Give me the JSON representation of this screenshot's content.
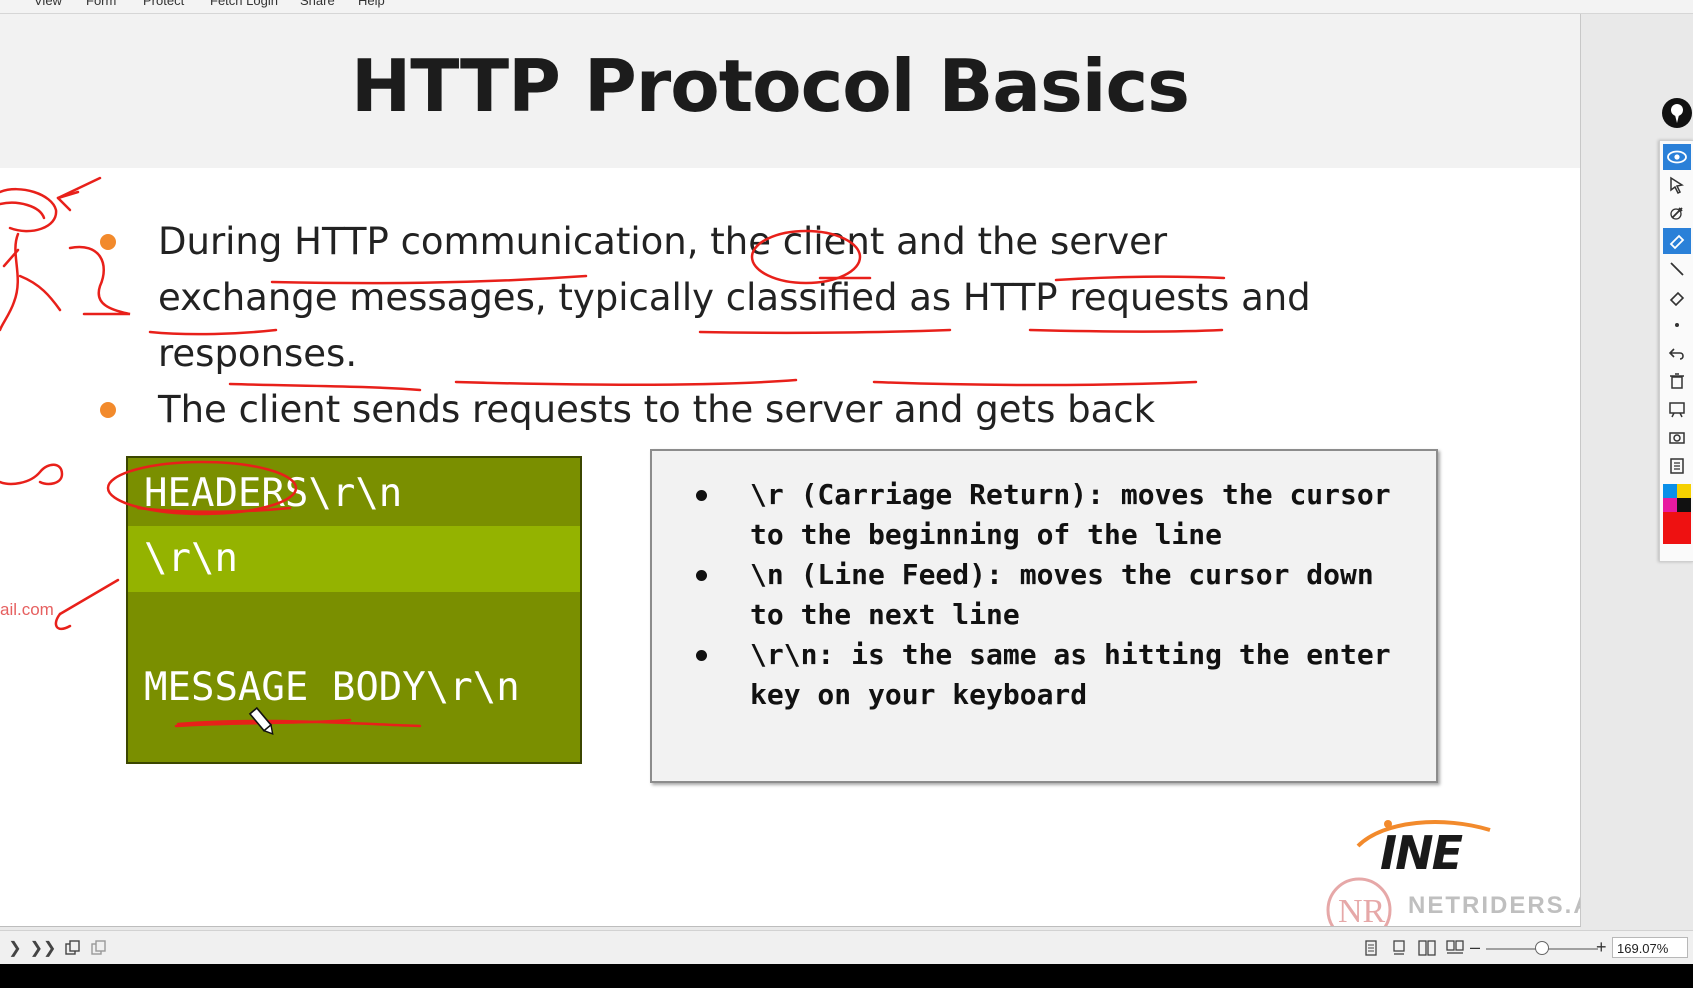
{
  "menu": [
    "View",
    "Form",
    "Protect",
    "Fetch Login",
    "Share",
    "Help"
  ],
  "slide": {
    "title": "HTTP Protocol Basics",
    "bullets": [
      "During HTTP communication, the client and the server exchange messages, typically classified as HTTP requests and responses.",
      "The client sends requests to the server and gets back responses."
    ],
    "message_box": {
      "headers": "HEADERS\\r\\n",
      "crlf": "\\r\\n",
      "body": "MESSAGE BODY\\r\\n"
    },
    "explanations": [
      "\\r (Carriage Return): moves the cursor to the beginning of the line",
      "\\n (Line Feed): moves the cursor down to the next line",
      "\\r\\n: is the same as hitting the enter key on your keyboard"
    ],
    "email_fragment": "ail.com",
    "logo_text": "INE",
    "watermark": "NETRIDERS.ACADEMY"
  },
  "statusbar": {
    "zoom_value": "169.07%",
    "zoom_level_fraction": 0.5
  },
  "colors": {
    "accent_orange": "#f28a2c",
    "box_green": "#7a8f00",
    "box_green_light": "#94b300",
    "ink_red": "#e8201a",
    "toolbar_active": "#2a80d8"
  },
  "icons": {
    "toolbar": [
      "eye-icon",
      "pointer-icon",
      "pen-icon",
      "highlighter-icon",
      "line-icon",
      "eraser-icon",
      "dot-icon",
      "undo-icon",
      "trash-icon",
      "whiteboard-icon",
      "camera-icon",
      "clipboard-icon",
      "color-palette-icon"
    ],
    "statusbar": [
      "next-page-icon",
      "last-page-icon",
      "copy-icon",
      "paste-icon",
      "single-page-icon",
      "continuous-icon",
      "two-page-icon",
      "two-page-continuous-icon"
    ]
  }
}
